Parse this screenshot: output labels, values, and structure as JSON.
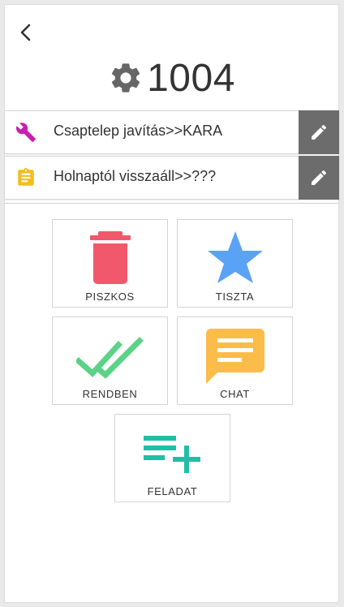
{
  "header": {
    "room_number": "1004"
  },
  "tasks": [
    {
      "text": "Csaptelep javítás>>KARA",
      "icon": "wrench-icon",
      "color": "#c81eb4"
    },
    {
      "text": "Holnaptól visszaáll>>???",
      "icon": "clipboard-icon",
      "color": "#f2bd1d"
    }
  ],
  "actions": [
    {
      "label": "PISZKOS",
      "icon": "trash-icon",
      "color": "#f2586c"
    },
    {
      "label": "TISZTA",
      "icon": "star-icon",
      "color": "#5aa2f5"
    },
    {
      "label": "RENDBEN",
      "icon": "double-check-icon",
      "color": "#5bd286"
    },
    {
      "label": "CHAT",
      "icon": "chat-icon",
      "color": "#fcbc4a"
    },
    {
      "label": "FELADAT",
      "icon": "playlist-add-icon",
      "color": "#1fbfa6"
    }
  ],
  "colors": {
    "edit_button_bg": "#6c6c6c",
    "text": "#333333"
  }
}
